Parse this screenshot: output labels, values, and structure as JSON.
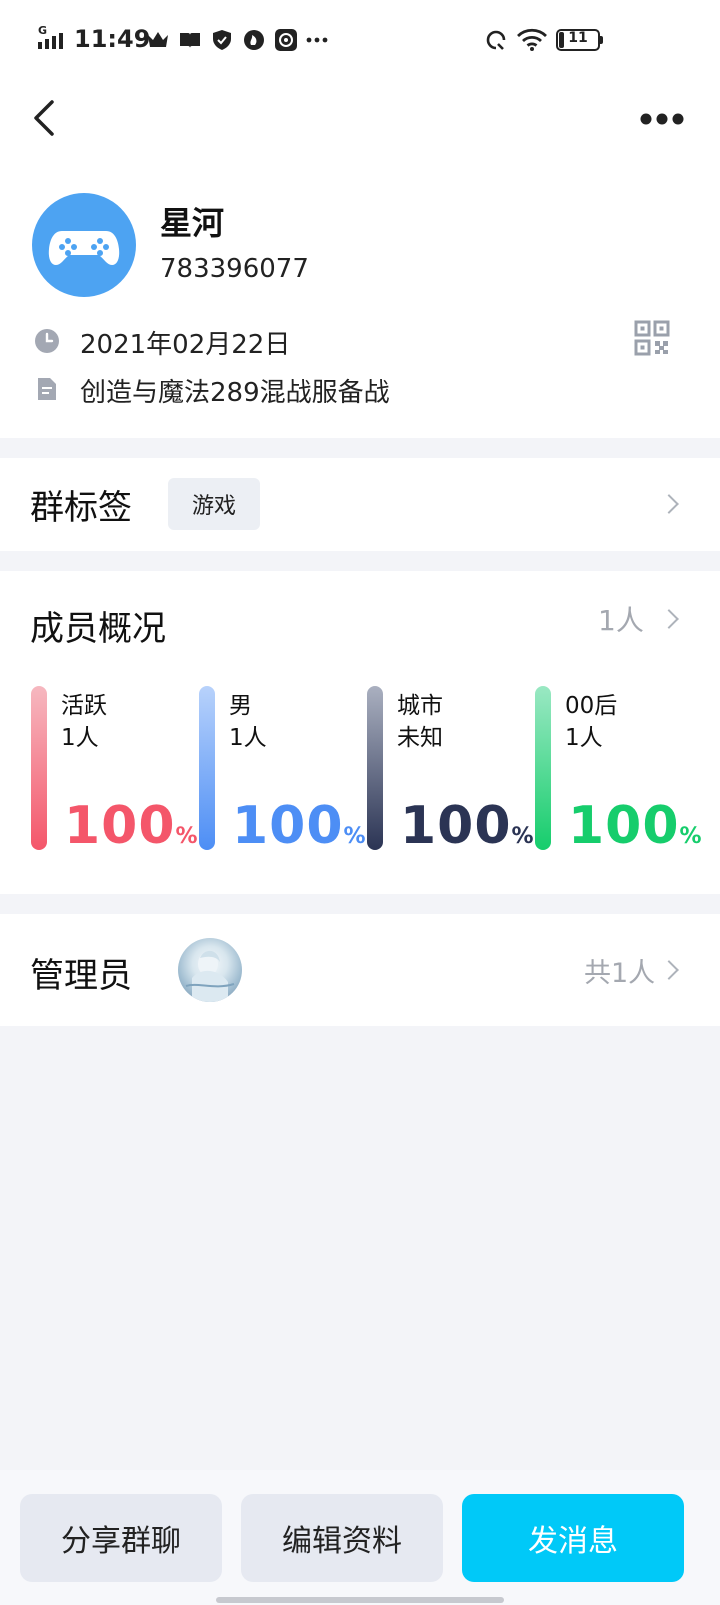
{
  "status_bar": {
    "network": "G",
    "time": "11:49",
    "battery_level": "11"
  },
  "group": {
    "name": "星河",
    "id": "783396077",
    "created_date": "2021年02月22日",
    "description": "创造与魔法289混战服备战"
  },
  "tags_section": {
    "title": "群标签",
    "tags": [
      "游戏"
    ]
  },
  "members_section": {
    "title": "成员概况",
    "count": "1人",
    "stats": [
      {
        "label": "活跃",
        "value": "1人",
        "percent": "100",
        "unit": "%",
        "color_top": "#f6b8c0",
        "color_bottom": "#f4566a",
        "text_color": "#f4566a"
      },
      {
        "label": "男",
        "value": "1人",
        "percent": "100",
        "unit": "%",
        "color_top": "#b8d2fb",
        "color_bottom": "#4d8ef5",
        "text_color": "#4d8ef5"
      },
      {
        "label": "城市",
        "value": "未知",
        "percent": "100",
        "unit": "%",
        "color_top": "#aab0c0",
        "color_bottom": "#2b3454",
        "text_color": "#2b3454"
      },
      {
        "label": "00后",
        "value": "1人",
        "percent": "100",
        "unit": "%",
        "color_top": "#9ae8c3",
        "color_bottom": "#16cd6c",
        "text_color": "#16cd6c"
      }
    ]
  },
  "admin_section": {
    "title": "管理员",
    "count_text": "共1人"
  },
  "bottom_bar": {
    "share_label": "分享群聊",
    "edit_label": "编辑资料",
    "message_label": "发消息"
  },
  "colors": {
    "primary": "#00c9f8",
    "avatar_bg": "#4da3f2",
    "page_bg": "#f3f4f8"
  }
}
